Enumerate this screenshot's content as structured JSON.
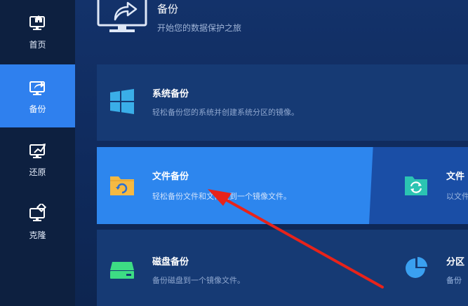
{
  "sidebar": {
    "items": [
      {
        "label": "首页",
        "icon": "home-monitor-icon"
      },
      {
        "label": "备份",
        "icon": "backup-monitor-icon"
      },
      {
        "label": "还原",
        "icon": "restore-monitor-icon"
      },
      {
        "label": "克隆",
        "icon": "clone-monitor-icon"
      }
    ],
    "active_index": 1
  },
  "header": {
    "title": "备份",
    "subtitle": "开始您的数据保护之旅"
  },
  "cards": [
    {
      "title": "系统备份",
      "description": "轻松备份您的系统并创建系统分区的镜像。",
      "icon": "windows-logo-icon"
    },
    {
      "title": "文件备份",
      "description": "轻松备份文件和文件夹到一个镜像文件。",
      "icon": "folder-backup-icon"
    },
    {
      "title": "磁盘备份",
      "description": "备份磁盘到一个镜像文件。",
      "icon": "disk-icon"
    }
  ],
  "cards_right": [
    {
      "title": "文件",
      "description": "以文件",
      "icon": "folder-sync-icon"
    },
    {
      "title": "分区",
      "description": "备份",
      "icon": "pie-partition-icon"
    }
  ],
  "colors": {
    "accent": "#2f80ee",
    "sidebar_bg": "#0d2040",
    "card_bg": "#163a74",
    "annotation_arrow": "#e8231a"
  }
}
